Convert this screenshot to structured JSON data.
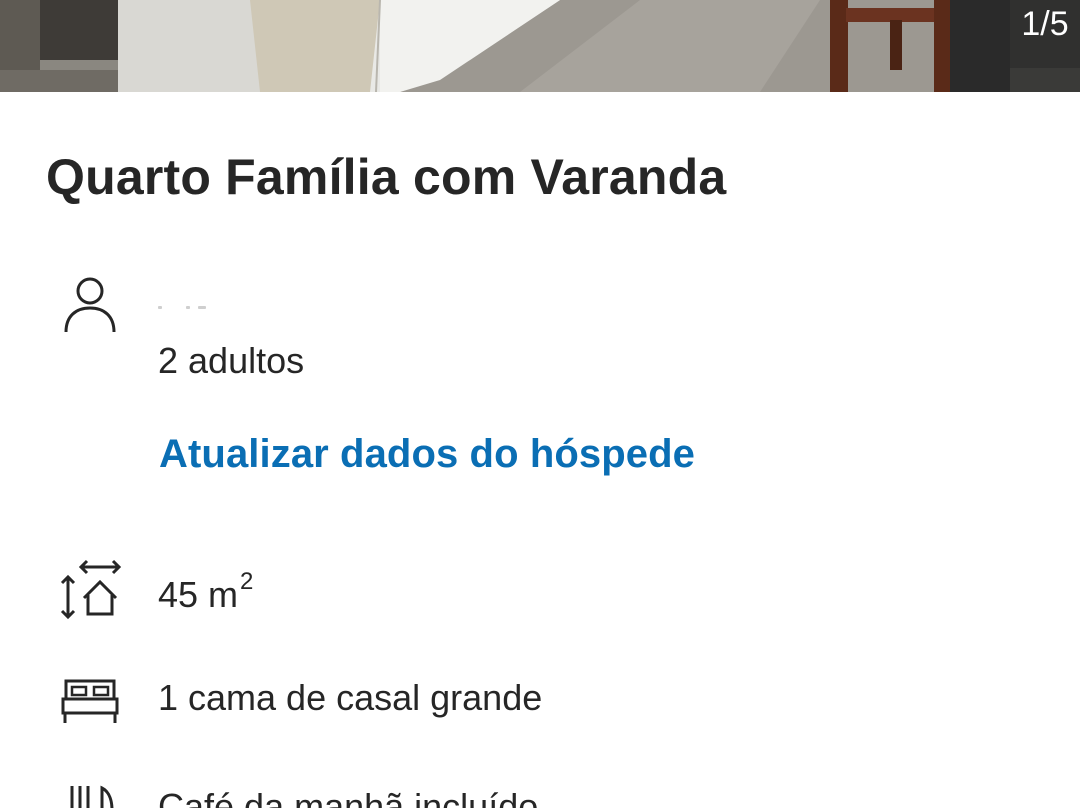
{
  "gallery": {
    "counter": "1/5"
  },
  "room": {
    "title": "Quarto Família com Varanda"
  },
  "guests": {
    "icon": "person-icon",
    "count_label": "2 adultos",
    "update_link": "Atualizar dados do hóspede"
  },
  "size": {
    "icon": "room-size-icon",
    "value": "45 m",
    "superscript": "2"
  },
  "bed": {
    "icon": "bed-icon",
    "label": "1 cama de casal grande"
  },
  "breakfast": {
    "icon": "cutlery-icon",
    "label": "Café da manhã incluído"
  },
  "colors": {
    "link": "#0a6eb4",
    "text": "#262626",
    "background": "#ffffff"
  }
}
